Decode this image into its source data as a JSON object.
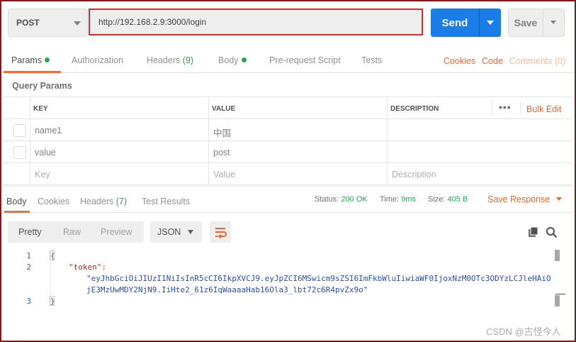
{
  "request": {
    "method": "POST",
    "url": "http://192.168.2.9:3000/login",
    "send_label": "Send",
    "save_label": "Save"
  },
  "request_tabs": {
    "params": "Params",
    "authorization": "Authorization",
    "headers": "Headers",
    "headers_count": "(9)",
    "body": "Body",
    "prerequest": "Pre-request Script",
    "tests": "Tests",
    "cookies": "Cookies",
    "code": "Code",
    "comments": "Comments (0)"
  },
  "query_params": {
    "title": "Query Params",
    "headers": {
      "key": "KEY",
      "value": "VALUE",
      "description": "DESCRIPTION"
    },
    "more": "•••",
    "bulk_edit": "Bulk Edit",
    "rows": [
      {
        "key": "name1",
        "value": "中国",
        "description": ""
      },
      {
        "key": "value",
        "value": "post",
        "description": ""
      }
    ],
    "placeholder": {
      "key": "Key",
      "value": "Value",
      "description": "Description"
    }
  },
  "response_tabs": {
    "body": "Body",
    "cookies": "Cookies",
    "headers": "Headers",
    "headers_count": "(7)",
    "test_results": "Test Results"
  },
  "status": {
    "status_label": "Status:",
    "status_value": "200 OK",
    "time_label": "Time:",
    "time_value": "9ms",
    "size_label": "Size:",
    "size_value": "405 B",
    "save_response": "Save Response"
  },
  "view": {
    "pretty": "Pretty",
    "raw": "Raw",
    "preview": "Preview",
    "format": "JSON"
  },
  "code": {
    "line_numbers": [
      "1",
      "2",
      "3"
    ],
    "open_brace": "{",
    "key": "\"token\":",
    "value_line1": "\"eyJhbGciOiJIUzI1NiIsInR5cCI6IkpXVCJ9.eyJpZCI6MSwicm9sZSI6ImFkbWluIiwiaWF0IjoxNzM0OTc3ODYzLCJleHAiO",
    "value_line2": "jE3MzUwMDY2NjN9.IiHte2_61z6IqWaaaaHab16Ola3_lbt72c6R4pvZx9o\"",
    "close_brace": "}"
  },
  "watermark": "CSDN @古怪今人",
  "colors": {
    "accent_orange": "#f26b3a",
    "send_blue": "#1a7de8",
    "status_green": "#26a65b",
    "url_highlight_red": "#d92b2b"
  }
}
